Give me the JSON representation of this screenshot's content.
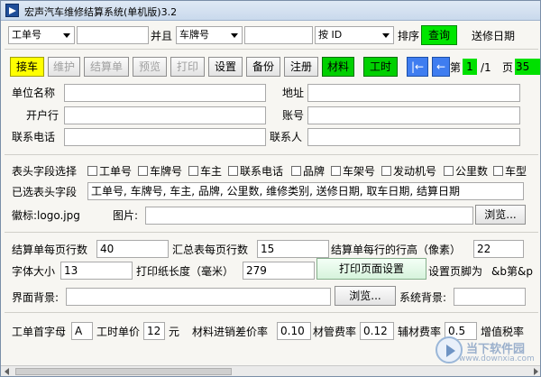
{
  "window": {
    "title": "宏声汽车维修结算系统(单机版)3.2"
  },
  "search": {
    "field1_value": "工单号",
    "and_label": "并且",
    "field2_value": "车牌号",
    "sort_by_value": "按 ID",
    "sort_label": "排序",
    "query_button": "查询",
    "date_field_value": "送修日期"
  },
  "toolbar": {
    "receive_car": "接车",
    "maintain": "维护",
    "settle": "结算单",
    "preview": "预览",
    "print": "打印",
    "settings": "设置",
    "backup": "备份",
    "register": "注册",
    "materials": "材料",
    "labor": "工时",
    "first_page": "|←",
    "prev_page": "←",
    "page_prefix": "第",
    "page_current": "1",
    "page_total": "/1",
    "page_suffix": "页",
    "page_extra": "35"
  },
  "company": {
    "name_label": "单位名称",
    "address_label": "地址",
    "bank_label": "开户行",
    "account_label": "账号",
    "phone_label": "联系电话",
    "contact_label": "联系人"
  },
  "header_fields": {
    "select_label": "表头字段选择",
    "options": [
      "工单号",
      "车牌号",
      "车主",
      "联系电话",
      "品牌",
      "车架号",
      "发动机号",
      "公里数",
      "车型"
    ],
    "selected_label": "已选表头字段",
    "selected_value": "工单号, 车牌号, 车主, 品牌, 公里数, 维修类别, 送修日期, 取车日期, 结算日期"
  },
  "logo": {
    "logo_label": "徽标:logo.jpg",
    "image_label": "图片:",
    "browse_button": "浏览..."
  },
  "print_settings": {
    "rows_per_page_label": "结算单每页行数",
    "rows_per_page_value": "40",
    "summary_rows_label": "汇总表每页行数",
    "summary_rows_value": "15",
    "row_height_label": "结算单每行的行高（像素）",
    "row_height_value": "22",
    "font_size_label": "字体大小",
    "font_size_value": "13",
    "paper_length_label": "打印纸长度（毫米）",
    "paper_length_value": "279",
    "page_setup_button": "打印页面设置",
    "footer_label": "设置页脚为",
    "footer_value": "&b第&p"
  },
  "background": {
    "ui_bg_label": "界面背景:",
    "browse_button": "浏览...",
    "system_bg_label": "系统背景:"
  },
  "rates": {
    "order_prefix_label": "工单首字母",
    "order_prefix_value": "A",
    "labor_price_label": "工时单价",
    "labor_price_value": "12",
    "labor_price_unit": "元",
    "material_markup_label": "材料进销差价率",
    "material_markup_value": "0.10",
    "mgmt_fee_label": "材管费率",
    "mgmt_fee_value": "0.12",
    "aux_fee_label": "辅材费率",
    "aux_fee_value": "0.5",
    "vat_label": "增值税率"
  },
  "watermark": {
    "text1": "当下软件园",
    "text2": "www.downxia.com"
  }
}
